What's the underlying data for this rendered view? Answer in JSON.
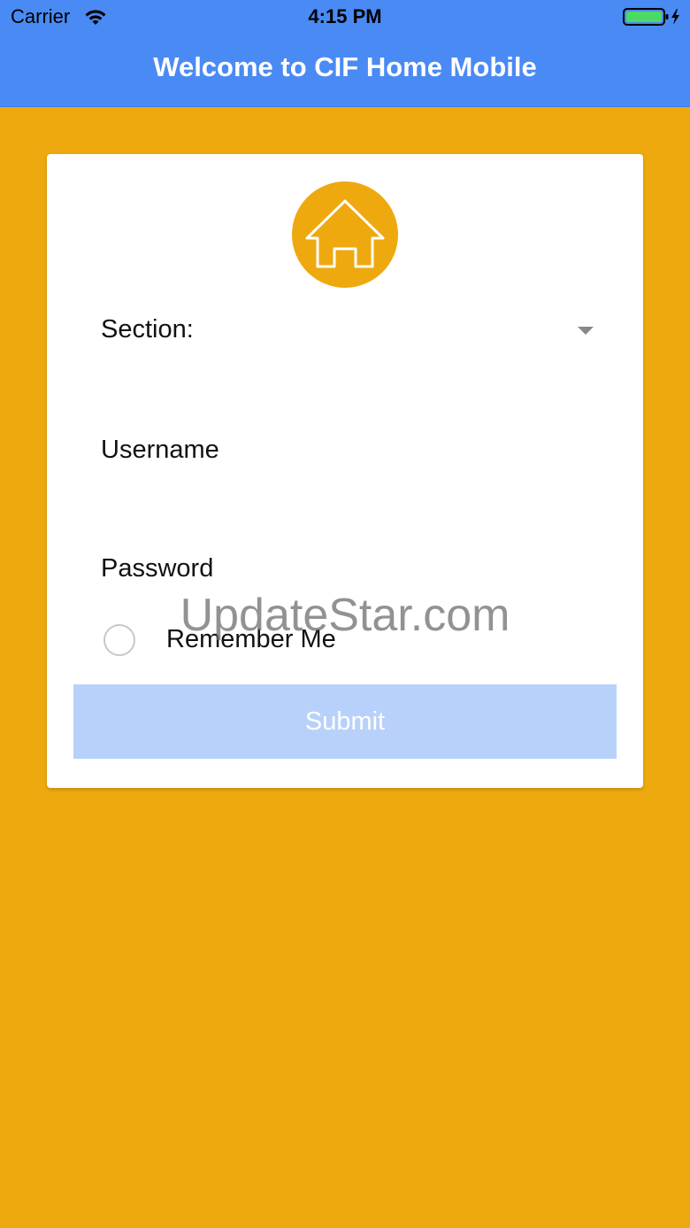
{
  "status_bar": {
    "carrier": "Carrier",
    "time": "4:15 PM",
    "wifi_icon": "wifi-icon",
    "battery_icon": "battery-charging-icon"
  },
  "nav": {
    "title": "Welcome to CIF Home Mobile"
  },
  "form": {
    "logo_icon": "house-icon",
    "section_label": "Section:",
    "section_dropdown_icon": "caret-down-icon",
    "username_placeholder": "Username",
    "username_value": "",
    "password_placeholder": "Password",
    "password_value": "",
    "remember_label": "Remember Me",
    "remember_checked": false,
    "submit_label": "Submit"
  },
  "watermark": "UpdateStar.com",
  "colors": {
    "background": "#eea90f",
    "header": "#4a8af4",
    "submit_disabled": "#b8d1fa",
    "card": "#ffffff"
  }
}
